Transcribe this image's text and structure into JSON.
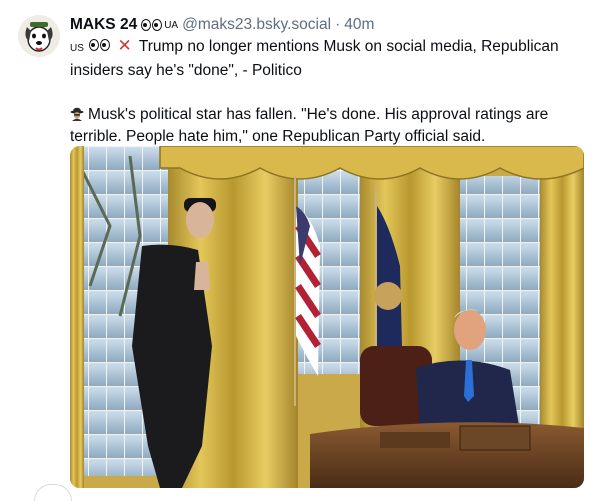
{
  "post": {
    "display_name": "MAKS 24",
    "name_flag": "UA",
    "handle": "@maks23.bsky.social",
    "separator": "·",
    "time": "40m",
    "text_line1_prefix": "US",
    "text_line1": "Trump no longer mentions Musk on social media, Republican",
    "text_line2": "insiders say he's \"done\", - Politico",
    "text_line3": "Musk's political star has fallen. \"He's done. His approval ratings are",
    "text_line4": "terrible. People hate him,\" one Republican Party official said."
  },
  "icons": {
    "avatar": "dog-avatar-icon",
    "eyes": "eyes-emoji-icon",
    "cross": "cross-mark-icon",
    "spy": "spy-detective-icon"
  },
  "colors": {
    "text": "#0b0f14",
    "muted": "#5d6f80",
    "cross": "#d23b2a"
  }
}
